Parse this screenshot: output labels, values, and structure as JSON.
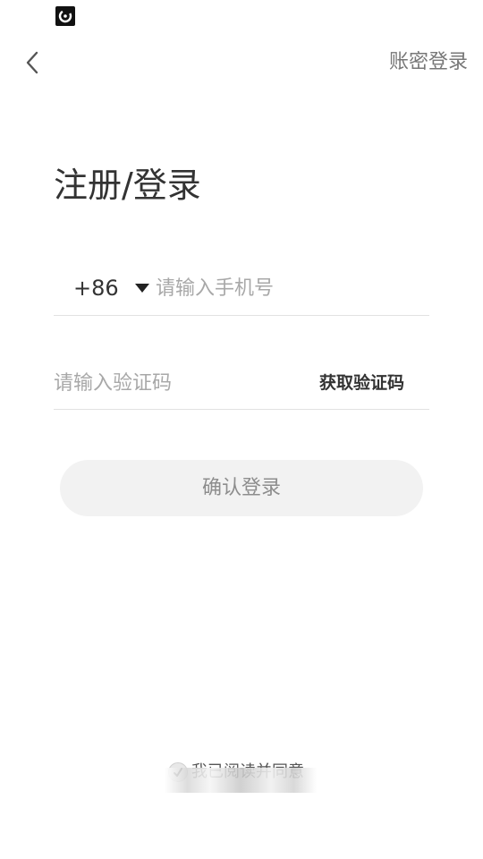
{
  "status_bar": {
    "app_icon": "game-app-icon"
  },
  "header": {
    "back_icon": "chevron-left-icon",
    "account_login_label": "账密登录"
  },
  "title": "注册/登录",
  "phone": {
    "country_code": "+86",
    "dropdown_icon": "caret-down-icon",
    "placeholder": "请输入手机号",
    "value": ""
  },
  "code": {
    "placeholder": "请输入验证码",
    "value": "",
    "get_code_label": "获取验证码"
  },
  "confirm_label": "确认登录",
  "agreement": {
    "checkbox_icon": "checkbox-circle-icon",
    "text": "我已阅读并同意"
  },
  "colors": {
    "primary_text": "#333333",
    "secondary_text": "#777777",
    "placeholder": "#a8a8a8",
    "button_bg": "#f2f2f2",
    "button_text": "#8d8d8d",
    "divider": "#e2e2e2"
  }
}
